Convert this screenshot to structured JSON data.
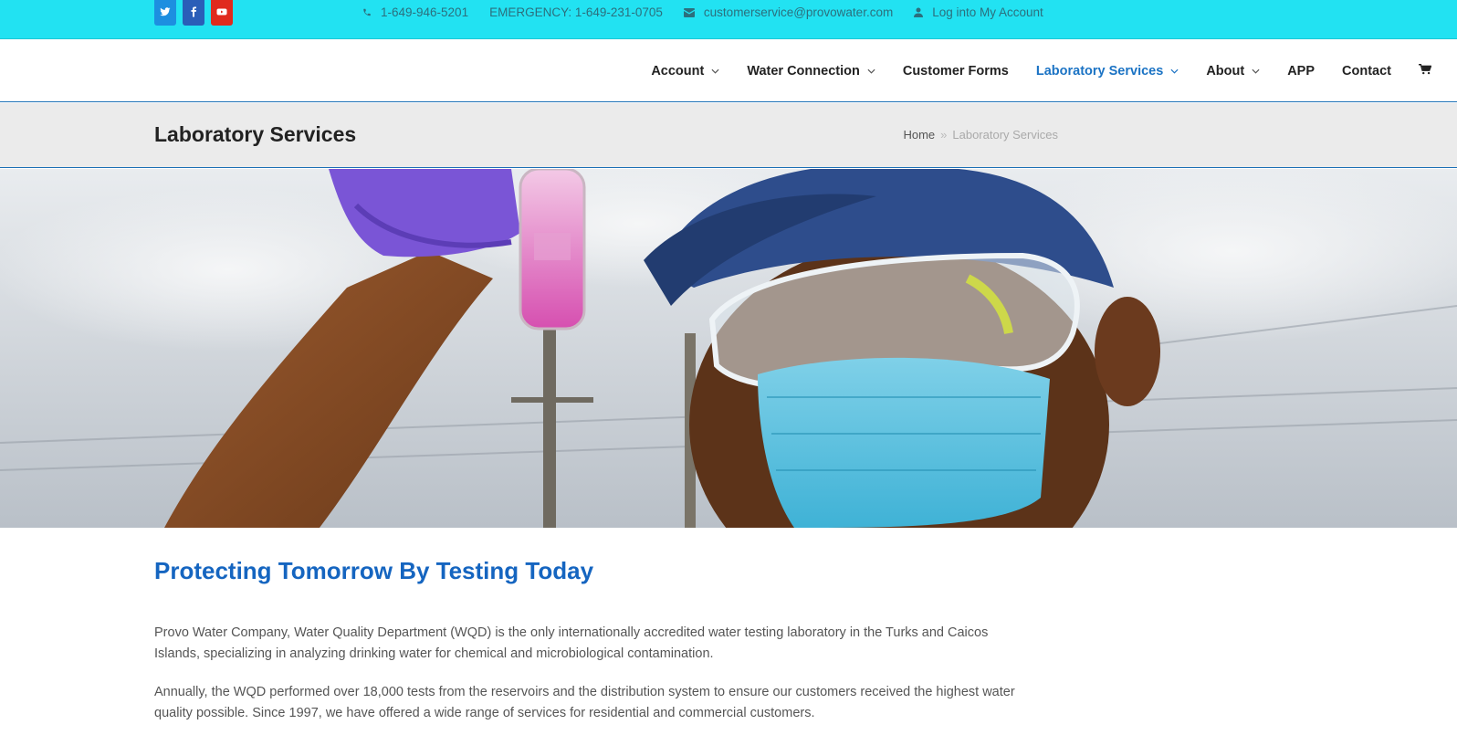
{
  "topbar": {
    "social": [
      "twitter-icon",
      "facebook-icon",
      "youtube-icon"
    ],
    "phone": "1-649-946-5201",
    "emergency": "EMERGENCY: 1-649-231-0705",
    "email": "customerservice@provowater.com",
    "login": "Log into My Account"
  },
  "nav": {
    "items": [
      {
        "label": "Account"
      },
      {
        "label": "Water Connection"
      },
      {
        "label": "Customer Forms"
      },
      {
        "label": "Laboratory Services"
      },
      {
        "label": "About"
      },
      {
        "label": "APP"
      },
      {
        "label": "Contact"
      }
    ]
  },
  "titlebar": {
    "title": "Laboratory Services",
    "breadcrumb_home": "Home",
    "breadcrumb_sep": "»",
    "breadcrumb_current": "Laboratory Services"
  },
  "content": {
    "headline": "Protecting Tomorrow By Testing Today",
    "paragraph1": "Provo Water Company, Water Quality Department (WQD) is the only internationally accredited water testing laboratory in the Turks and Caicos Islands, specializing in analyzing drinking water for chemical and microbiological contamination.",
    "paragraph2": "Annually, the WQD performed over 18,000 tests from the reservoirs and the distribution system to ensure our customers received the highest water quality possible.  Since 1997, we have offered a wide range of services for residential and commercial customers."
  },
  "colors": {
    "topbar": "#22e2f2",
    "accent": "#1b73c4",
    "headline": "#1565c0"
  }
}
